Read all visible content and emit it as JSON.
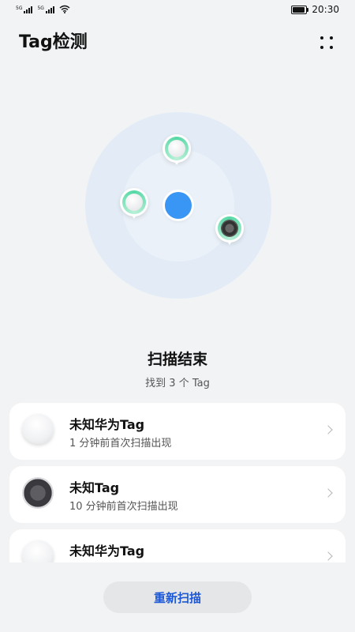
{
  "status_bar": {
    "time": "20:30",
    "signal_1_tag": "5G",
    "signal_2_tag": "5G"
  },
  "header": {
    "title": "Tag检测",
    "more_icon": "more-dots-icon"
  },
  "radar": {
    "center_color": "#3a96f4",
    "pins": [
      {
        "device": "white-tag",
        "color": "#55d8a5"
      },
      {
        "device": "white-tag",
        "color": "#55d8a5"
      },
      {
        "device": "dark-tag",
        "color": "#55d8a5"
      }
    ]
  },
  "scan_status": {
    "title": "扫描结束",
    "subtitle": "找到 3 个 Tag"
  },
  "tags": [
    {
      "name": "未知华为Tag",
      "time": "1 分钟前首次扫描出现",
      "thumb": "white"
    },
    {
      "name": "未知Tag",
      "time": "10 分钟前首次扫描出现",
      "thumb": "dark"
    },
    {
      "name": "未知华为Tag",
      "time": "",
      "thumb": "white"
    }
  ],
  "rescan_button": {
    "label": "重新扫描",
    "color": "#1d58d6"
  }
}
